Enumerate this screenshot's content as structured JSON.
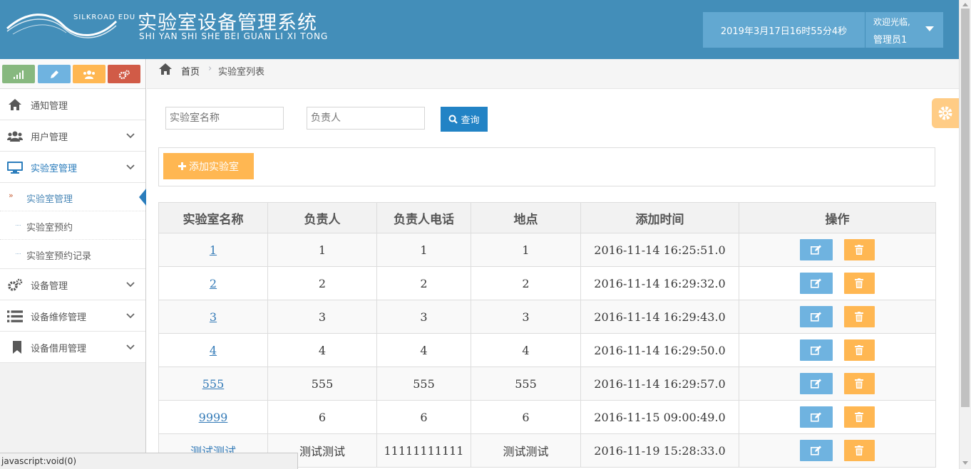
{
  "header": {
    "logo_small": "SILKROAD EDU",
    "title": "实验室设备管理系统",
    "subtitle": "SHI YAN SHI SHE BEI GUAN LI XI TONG",
    "datetime": "2019年3月17日16时55分4秒",
    "welcome": "欢迎光临,",
    "username": "管理员1"
  },
  "sidebar": {
    "shortcuts": [
      "signal-icon",
      "pencil-icon",
      "users-icon",
      "cogs-icon"
    ],
    "items": [
      {
        "label": "通知管理",
        "icon": "home-icon"
      },
      {
        "label": "用户管理",
        "icon": "users-icon"
      },
      {
        "label": "实验室管理",
        "icon": "desktop-icon"
      },
      {
        "label": "设备管理",
        "icon": "cogs-icon"
      },
      {
        "label": "设备维修管理",
        "icon": "list-icon"
      },
      {
        "label": "设备借用管理",
        "icon": "bookmark-icon"
      }
    ],
    "sub_items": [
      "实验室管理",
      "实验室预约",
      "实验室预约记录"
    ]
  },
  "breadcrumb": {
    "home": "首页",
    "current": "实验室列表"
  },
  "search": {
    "name_placeholder": "实验室名称",
    "owner_placeholder": "负责人",
    "button": "查询"
  },
  "toolbar": {
    "add_button": "添加实验室"
  },
  "table": {
    "headers": [
      "实验室名称",
      "负责人",
      "负责人电话",
      "地点",
      "添加时间",
      "操作"
    ],
    "rows": [
      {
        "name": "1",
        "owner": "1",
        "phone": "1",
        "location": "1",
        "time": "2016-11-14 16:25:51.0"
      },
      {
        "name": "2",
        "owner": "2",
        "phone": "2",
        "location": "2",
        "time": "2016-11-14 16:29:32.0"
      },
      {
        "name": "3",
        "owner": "3",
        "phone": "3",
        "location": "3",
        "time": "2016-11-14 16:29:43.0"
      },
      {
        "name": "4",
        "owner": "4",
        "phone": "4",
        "location": "4",
        "time": "2016-11-14 16:29:50.0"
      },
      {
        "name": "555",
        "owner": "555",
        "phone": "555",
        "location": "555",
        "time": "2016-11-14 16:29:57.0"
      },
      {
        "name": "9999",
        "owner": "6",
        "phone": "6",
        "location": "6",
        "time": "2016-11-15 09:00:49.0"
      },
      {
        "name": "测试测试",
        "owner": "测试测试",
        "phone": "11111111111",
        "location": "测试测试",
        "time": "2016-11-19 15:28:33.0"
      }
    ]
  },
  "status_bar": "javascript:void(0)",
  "colors": {
    "header_bg": "#438eb9",
    "accent_blue": "#2283c5",
    "edit_btn": "#6fb3e0",
    "delete_btn": "#ffb752"
  }
}
